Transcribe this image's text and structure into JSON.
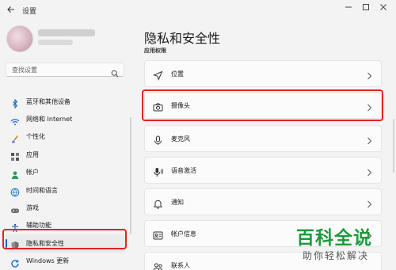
{
  "titlebar": {
    "title": "设置",
    "back_icon": "arrow-left-icon",
    "controls": [
      "minimize-icon",
      "maximize-icon",
      "close-icon"
    ]
  },
  "sidebar": {
    "search": {
      "placeholder": "查找设置",
      "icon": "search-icon"
    },
    "items": [
      {
        "label": "蓝牙和其他设备",
        "icon": "bluetooth-icon"
      },
      {
        "label": "网络和 Internet",
        "icon": "wifi-icon"
      },
      {
        "label": "个性化",
        "icon": "brush-icon"
      },
      {
        "label": "应用",
        "icon": "apps-icon"
      },
      {
        "label": "帐户",
        "icon": "person-icon"
      },
      {
        "label": "时间和语言",
        "icon": "globe-clock-icon"
      },
      {
        "label": "游戏",
        "icon": "gamepad-icon"
      },
      {
        "label": "辅助功能",
        "icon": "accessibility-icon"
      },
      {
        "label": "隐私和安全性",
        "icon": "shield-icon",
        "selected": true
      },
      {
        "label": "Windows 更新",
        "icon": "update-icon"
      }
    ]
  },
  "main": {
    "title": "隐私和安全性",
    "section_label": "应用权限",
    "rows": [
      {
        "label": "位置",
        "icon": "location-arrow-icon"
      },
      {
        "label": "摄像头",
        "icon": "camera-icon",
        "highlighted": true
      },
      {
        "label": "麦克风",
        "icon": "microphone-icon"
      },
      {
        "label": "语音激活",
        "icon": "voice-activation-icon"
      },
      {
        "label": "通知",
        "icon": "bell-icon"
      },
      {
        "label": "帐户信息",
        "icon": "account-info-icon"
      },
      {
        "label": "联系人",
        "icon": "contacts-icon"
      }
    ]
  },
  "watermark": {
    "logo": "百科全说",
    "subtitle": "助你轻松解决"
  },
  "colors": {
    "accent": "#0067c0",
    "highlight_border": "#e02424",
    "watermark_green": "#1d9a3c"
  }
}
